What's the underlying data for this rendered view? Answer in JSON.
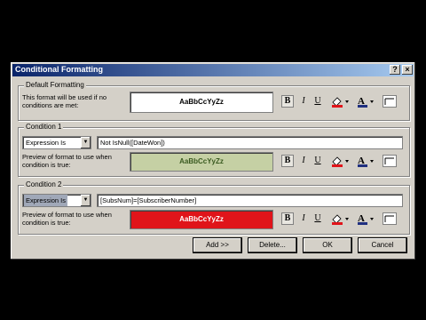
{
  "dialog": {
    "title": "Conditional Formatting",
    "help_label": "?",
    "close_label": "×"
  },
  "default_formatting": {
    "legend": "Default Formatting",
    "description": "This format will be used if no conditions are met:",
    "preview_text": "AaBbCcYyZz"
  },
  "conditions": [
    {
      "legend": "Condition 1",
      "type": "Expression Is",
      "expression": "Not IsNull([DateWon])",
      "preview_label": "Preview of format to use when condition is true:",
      "preview_text": "AaBbCcYyZz",
      "preview_bg": "#c5d0a4",
      "preview_fg": "#3a5a20"
    },
    {
      "legend": "Condition 2",
      "type": "Expression Is",
      "expression": "[SubsNum]=[SubscriberNumber]",
      "preview_label": "Preview of format to use when condition is true:",
      "preview_text": "AaBbCcYyZz",
      "preview_bg": "#e0141a",
      "preview_fg": "#ffffff"
    }
  ],
  "toolbar": {
    "bold": "B",
    "italic": "I",
    "underline": "U",
    "font_color_letter": "A"
  },
  "buttons": {
    "add": "Add >>",
    "delete": "Delete...",
    "ok": "OK",
    "cancel": "Cancel"
  },
  "colors": {
    "title_bar": "#0a246a",
    "dialog_bg": "#d4d0c8",
    "selected_combo": "#a0a8b8"
  }
}
